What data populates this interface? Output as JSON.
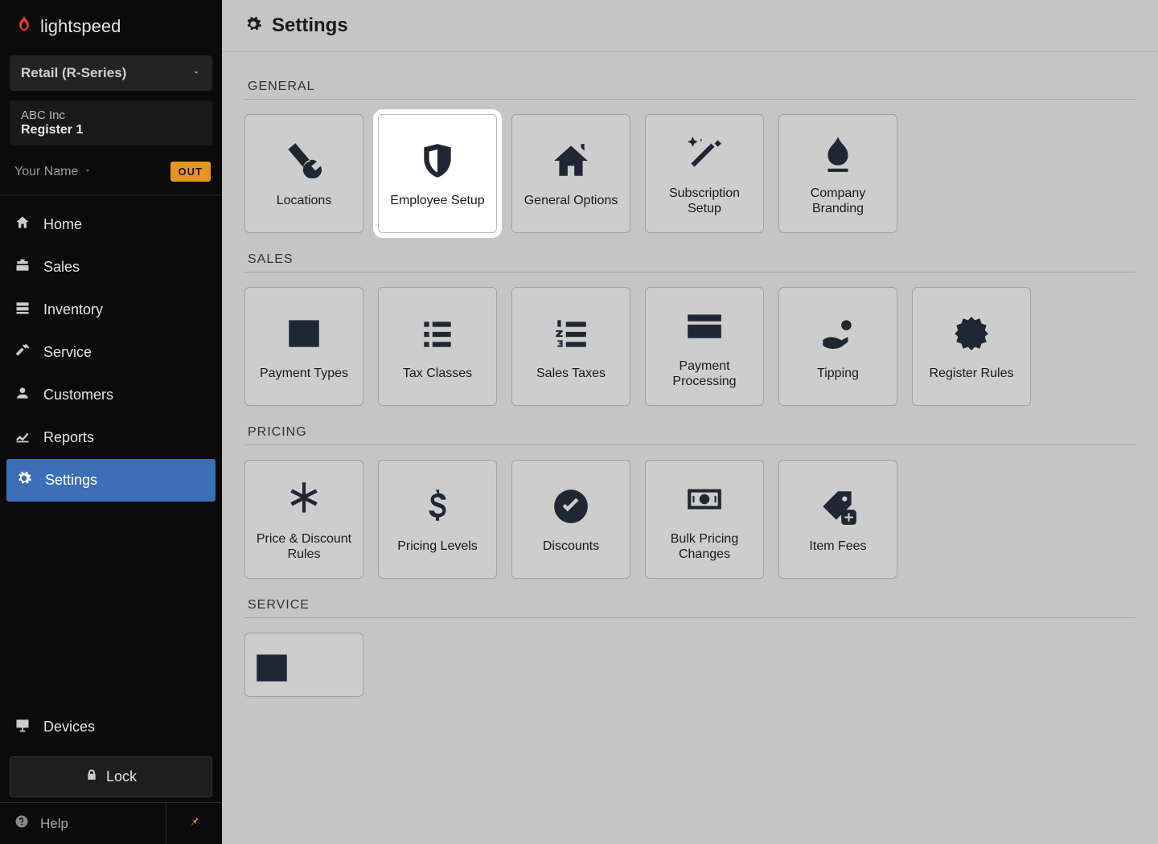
{
  "brand": "lightspeed",
  "series": {
    "label": "Retail (R-Series)"
  },
  "company": {
    "name": "ABC Inc",
    "register": "Register 1"
  },
  "user": {
    "name": "Your Name",
    "status_badge": "OUT"
  },
  "nav": [
    {
      "key": "home",
      "label": "Home"
    },
    {
      "key": "sales",
      "label": "Sales"
    },
    {
      "key": "inventory",
      "label": "Inventory"
    },
    {
      "key": "service",
      "label": "Service"
    },
    {
      "key": "customers",
      "label": "Customers"
    },
    {
      "key": "reports",
      "label": "Reports"
    },
    {
      "key": "settings",
      "label": "Settings"
    }
  ],
  "devices_label": "Devices",
  "lock_label": "Lock",
  "help_label": "Help",
  "page": {
    "title": "Settings",
    "sections": {
      "general": {
        "heading": "GENERAL",
        "tiles": [
          {
            "key": "locations",
            "label": "Locations"
          },
          {
            "key": "employee-setup",
            "label": "Employee Setup",
            "highlight": true
          },
          {
            "key": "general-options",
            "label": "General Options"
          },
          {
            "key": "subscription-setup",
            "label": "Subscription Setup"
          },
          {
            "key": "company-branding",
            "label": "Company Branding"
          }
        ]
      },
      "sales": {
        "heading": "SALES",
        "tiles": [
          {
            "key": "payment-types",
            "label": "Payment Types"
          },
          {
            "key": "tax-classes",
            "label": "Tax Classes"
          },
          {
            "key": "sales-taxes",
            "label": "Sales Taxes"
          },
          {
            "key": "payment-processing",
            "label": "Payment Processing"
          },
          {
            "key": "tipping",
            "label": "Tipping"
          },
          {
            "key": "register-rules",
            "label": "Register Rules"
          }
        ]
      },
      "pricing": {
        "heading": "PRICING",
        "tiles": [
          {
            "key": "price-discount-rules",
            "label": "Price & Discount Rules"
          },
          {
            "key": "pricing-levels",
            "label": "Pricing Levels"
          },
          {
            "key": "discounts",
            "label": "Discounts"
          },
          {
            "key": "bulk-pricing-changes",
            "label": "Bulk Pricing Changes"
          },
          {
            "key": "item-fees",
            "label": "Item Fees"
          }
        ]
      },
      "service": {
        "heading": "SERVICE",
        "tiles": []
      }
    }
  }
}
